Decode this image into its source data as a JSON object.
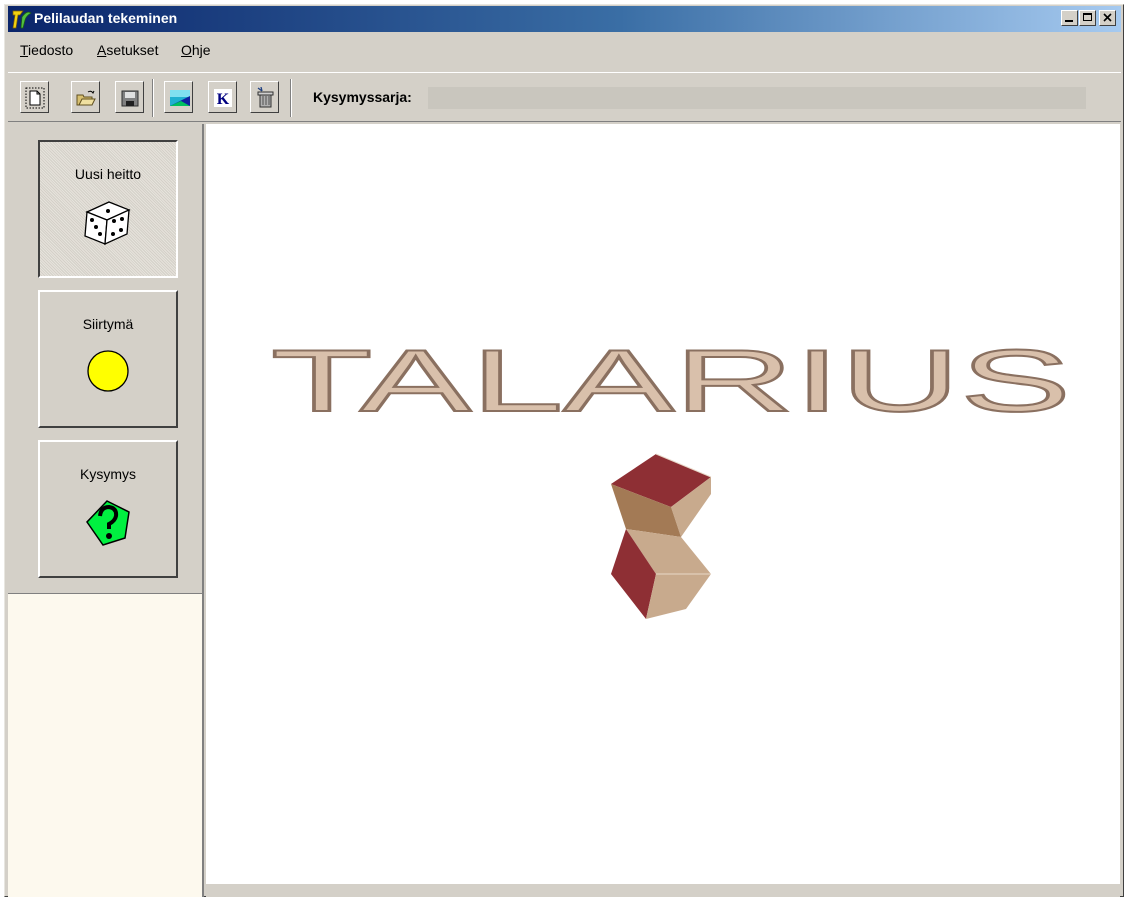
{
  "window": {
    "title": "Pelilaudan tekeminen",
    "controls": {
      "minimize": "_",
      "maximize": "□",
      "close": "x"
    }
  },
  "menu": [
    {
      "label": "Tiedosto",
      "accel": "T",
      "rest": "iedosto"
    },
    {
      "label": "Asetukset",
      "accel": "A",
      "rest": "setukset"
    },
    {
      "label": "Ohje",
      "accel": "O",
      "rest": "hje"
    }
  ],
  "toolbar": {
    "buttons": [
      "new-document-icon",
      "open-folder-icon",
      "save-disk-icon",
      "background-image-icon",
      "question-set-k-icon",
      "delete-trash-icon"
    ],
    "k_glyph": "K",
    "field_label": "Kysymyssarja:",
    "field_value": ""
  },
  "tools": [
    {
      "label": "Uusi heitto",
      "icon": "dice-icon",
      "pressed": true
    },
    {
      "label": "Siirtymä",
      "icon": "yellow-circle-icon",
      "pressed": false
    },
    {
      "label": "Kysymys",
      "icon": "question-pentagon-icon",
      "pressed": false
    }
  ],
  "canvas": {
    "logo_text": "TALARIUS",
    "colors": {
      "logo_fill": "#d9c0ab",
      "logo_stroke": "#8a7060",
      "cube_dark": "#8e2f34",
      "cube_mid": "#a37a55",
      "cube_light": "#c8aa8d"
    }
  }
}
